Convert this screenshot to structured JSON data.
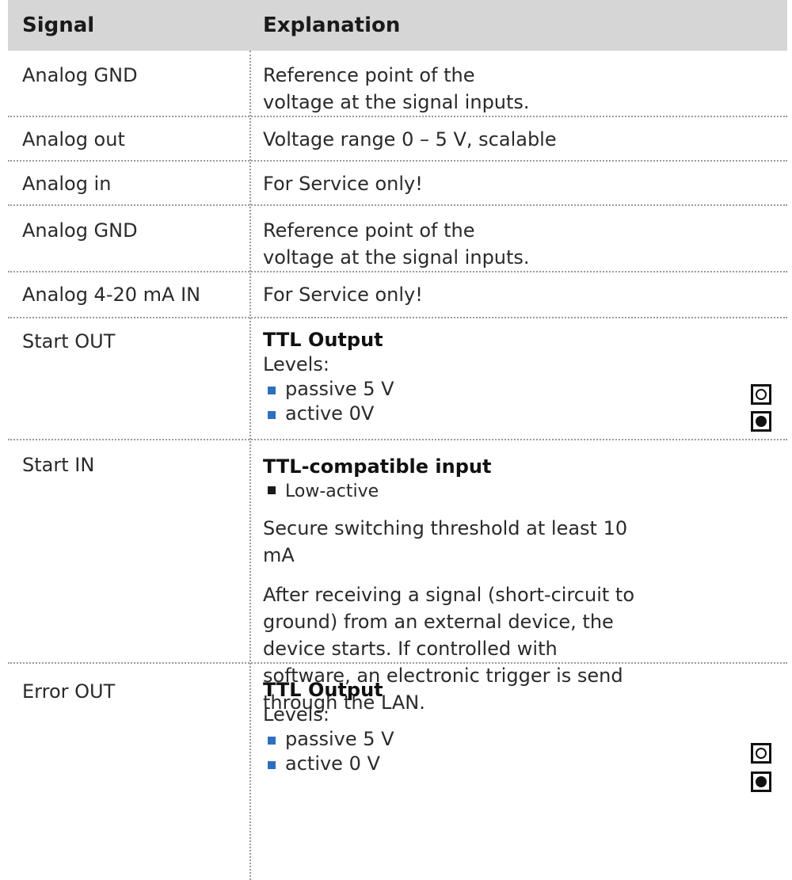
{
  "header": {
    "signal": "Signal",
    "explanation": "Explanation"
  },
  "rows": [
    {
      "signal": "Analog GND",
      "explanation": "Reference point of the voltage at the signal inputs."
    },
    {
      "signal": "Analog out",
      "explanation": "Voltage range 0 – 5 V, scalable"
    },
    {
      "signal": "Analog in",
      "explanation": "For Service only!"
    },
    {
      "signal": "Analog GND",
      "explanation": "Reference point of the voltage at the signal inputs."
    },
    {
      "signal": "Analog 4-20 mA IN",
      "explanation": "For Service only!"
    },
    {
      "signal": "Start OUT",
      "title": "TTL Output",
      "levels_label": "Levels:",
      "items": [
        "passive 5 V",
        "active 0V"
      ]
    },
    {
      "signal": "Start IN",
      "title": "TTL-compatible input",
      "items": [
        "Low-active"
      ],
      "para1": "Secure switching threshold at least 10 mA",
      "para2": "After receiving a signal (short-circuit to ground) from an external device, the device starts. If controlled with software, an electronic trigger is send through the LAN."
    },
    {
      "signal": "Error OUT",
      "title": "TTL Output",
      "levels_label": "Levels:",
      "items": [
        "passive 5 V",
        "active 0 V"
      ]
    }
  ],
  "colors": {
    "header_bg": "#d6d6d6",
    "bullet_blue": "#2e6fc0",
    "bullet_black": "#1a1a1a",
    "divider": "#9a9a9a"
  },
  "icons": {
    "passive": "led-off-icon",
    "active": "led-on-icon"
  }
}
